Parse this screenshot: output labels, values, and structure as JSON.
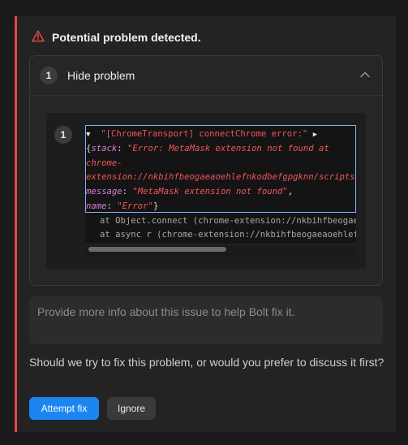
{
  "alert": {
    "title": "Potential problem detected.",
    "accent_color": "#e5484d",
    "icon": "warning-triangle-icon"
  },
  "problem_card": {
    "number": "1",
    "toggle_label": "Hide problem",
    "toggle_icon": "chevron-up-icon",
    "log_entry": {
      "number": "1",
      "message": "\"[ChromeTransport] connectChrome error:\"",
      "object_open": "{",
      "stack_key": "stack",
      "stack_value_1": "\"Error: MetaMask extension not found at",
      "stack_value_2": "chrome-",
      "stack_value_3": "extension://nkbihfbeogaeaoehlefnkodbefgpgknn/scripts/",
      "message_key": "message",
      "message_value": "\"MetaMask extension not found\"",
      "name_key": "name",
      "name_value": "\"Error\"",
      "object_close": "}",
      "trace": [
        "at Object.connect (chrome-extension://nkbihfbeogaeaoehlefnkodbefgpgknn",
        "at async r (chrome-extension://nkbihfbeogaeaoehlefnkodbefgpgknn/scripts"
      ]
    }
  },
  "feedback": {
    "placeholder": "Provide more info about this issue to help Bolt fix it."
  },
  "question": "Should we try to fix this problem, or would you prefer to discuss it first?",
  "actions": {
    "primary": "Attempt fix",
    "secondary": "Ignore",
    "primary_color": "#1b86f2"
  }
}
